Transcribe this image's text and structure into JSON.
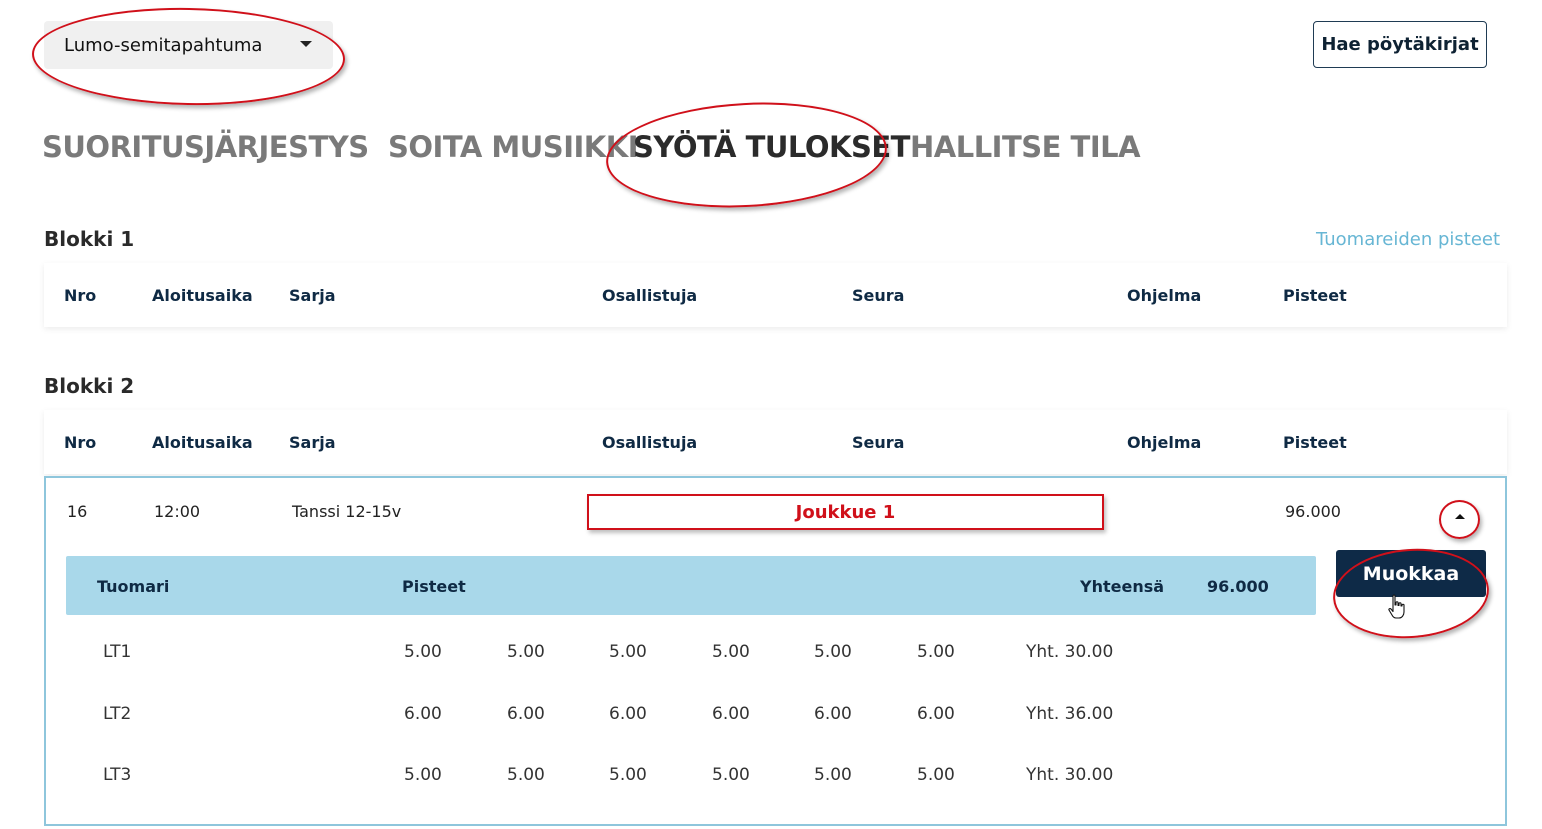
{
  "topbar": {
    "event_select_value": "Lumo-semitapahtuma",
    "fetch_button_label": "Hae pöytäkirjat"
  },
  "tabs": [
    {
      "label": "SUORITUSJÄRJESTYS",
      "active": false
    },
    {
      "label": "SOITA MUSIIKKI",
      "active": false
    },
    {
      "label": "SYÖTÄ TULOKSET",
      "active": true
    },
    {
      "label": "HALLITSE TILA",
      "active": false
    }
  ],
  "judges_points_link": "Tuomareiden pisteet",
  "columns": [
    "Nro",
    "Aloitusaika",
    "Sarja",
    "Osallistuja",
    "Seura",
    "Ohjelma",
    "Pisteet"
  ],
  "blocks": [
    {
      "title": "Blokki 1"
    },
    {
      "title": "Blokki 2"
    }
  ],
  "entry": {
    "nro": "16",
    "start_time": "12:00",
    "series": "Tanssi 12-15v",
    "participant": "Joukkue 1",
    "points": "96.000"
  },
  "judges_table": {
    "judge_header": "Tuomari",
    "points_header": "Pisteet",
    "total_label": "Yhteensä",
    "total_value": "96.000",
    "edit_button_label": "Muokkaa",
    "rows": [
      {
        "judge": "LT1",
        "scores": [
          "5.00",
          "5.00",
          "5.00",
          "5.00",
          "5.00",
          "5.00"
        ],
        "total": "Yht. 30.00"
      },
      {
        "judge": "LT2",
        "scores": [
          "6.00",
          "6.00",
          "6.00",
          "6.00",
          "6.00",
          "6.00"
        ],
        "total": "Yht. 36.00"
      },
      {
        "judge": "LT3",
        "scores": [
          "5.00",
          "5.00",
          "5.00",
          "5.00",
          "5.00",
          "5.00"
        ],
        "total": "Yht. 30.00"
      }
    ]
  },
  "colors": {
    "annotation_red": "#d0101a",
    "navy": "#0e2a47",
    "light_blue": "#a9d8ea",
    "link_blue": "#67b6d4"
  }
}
